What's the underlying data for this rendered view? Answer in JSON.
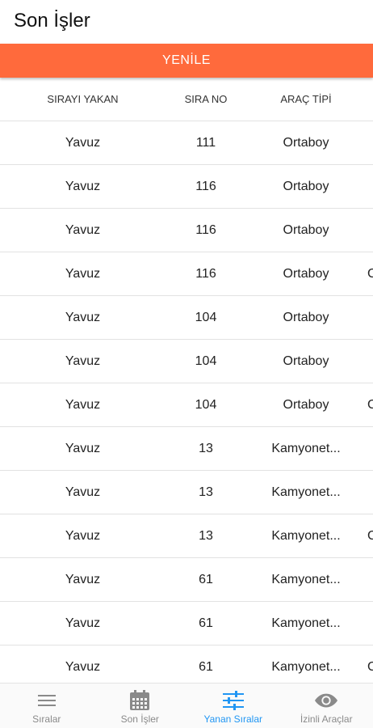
{
  "header": {
    "title": "Son İşler"
  },
  "refresh_button": {
    "label": "YENİLE"
  },
  "table": {
    "columns": [
      "SIRAYI YAKAN",
      "SIRA NO",
      "ARAÇ TİPİ"
    ],
    "rows": [
      {
        "sirayi_yakan": "Yavuz",
        "sira_no": "111",
        "arac_tipi": "Ortaboy",
        "extra": ""
      },
      {
        "sirayi_yakan": "Yavuz",
        "sira_no": "116",
        "arac_tipi": "Ortaboy",
        "extra": ""
      },
      {
        "sirayi_yakan": "Yavuz",
        "sira_no": "116",
        "arac_tipi": "Ortaboy",
        "extra": ""
      },
      {
        "sirayi_yakan": "Yavuz",
        "sira_no": "116",
        "arac_tipi": "Ortaboy",
        "extra": "C"
      },
      {
        "sirayi_yakan": "Yavuz",
        "sira_no": "104",
        "arac_tipi": "Ortaboy",
        "extra": ""
      },
      {
        "sirayi_yakan": "Yavuz",
        "sira_no": "104",
        "arac_tipi": "Ortaboy",
        "extra": ""
      },
      {
        "sirayi_yakan": "Yavuz",
        "sira_no": "104",
        "arac_tipi": "Ortaboy",
        "extra": "C"
      },
      {
        "sirayi_yakan": "Yavuz",
        "sira_no": "13",
        "arac_tipi": "Kamyonet...",
        "extra": ""
      },
      {
        "sirayi_yakan": "Yavuz",
        "sira_no": "13",
        "arac_tipi": "Kamyonet...",
        "extra": ""
      },
      {
        "sirayi_yakan": "Yavuz",
        "sira_no": "13",
        "arac_tipi": "Kamyonet...",
        "extra": "C"
      },
      {
        "sirayi_yakan": "Yavuz",
        "sira_no": "61",
        "arac_tipi": "Kamyonet...",
        "extra": ""
      },
      {
        "sirayi_yakan": "Yavuz",
        "sira_no": "61",
        "arac_tipi": "Kamyonet...",
        "extra": ""
      },
      {
        "sirayi_yakan": "Yavuz",
        "sira_no": "61",
        "arac_tipi": "Kamyonet...",
        "extra": "C"
      }
    ]
  },
  "bottom_nav": {
    "items": [
      {
        "label": "Sıralar",
        "icon": "menu-icon",
        "active": false
      },
      {
        "label": "Son İşler",
        "icon": "calendar-icon",
        "active": false
      },
      {
        "label": "Yanan Sıralar",
        "icon": "sliders-icon",
        "active": true
      },
      {
        "label": "İzinli Araçlar",
        "icon": "eye-icon",
        "active": false
      }
    ]
  },
  "colors": {
    "accent": "#ff6a3c",
    "active_nav": "#2196f3",
    "inactive_nav": "#8a8a8a"
  }
}
